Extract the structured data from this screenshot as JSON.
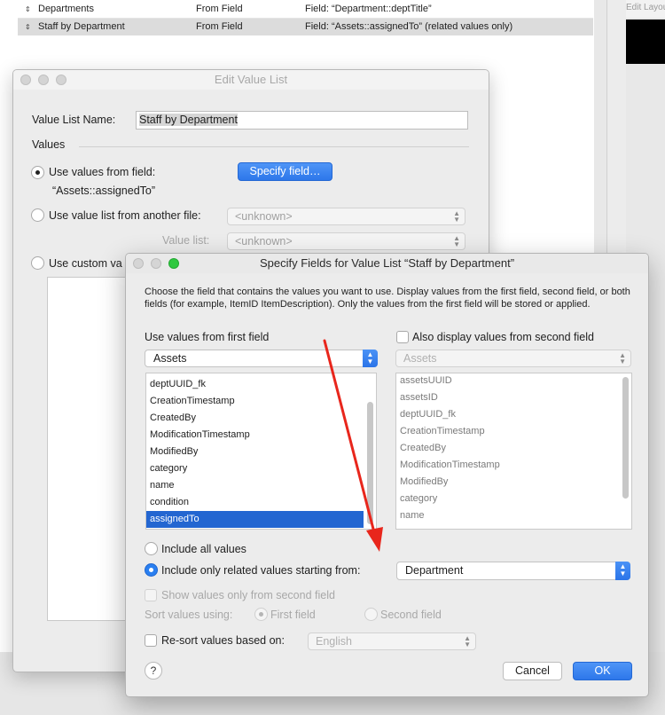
{
  "background_list": {
    "rows": [
      {
        "name": "Departments",
        "type": "From Field",
        "source": "Field: “Department::deptTitle”"
      },
      {
        "name": "Staff by Department",
        "type": "From Field",
        "source": "Field: “Assets::assignedTo” (related values only)"
      }
    ],
    "layout_panel_text": "Edit Layou"
  },
  "edit_value_list": {
    "title": "Edit Value List",
    "name_label": "Value List Name:",
    "name_value": "Staff by Department",
    "values_heading": "Values",
    "use_field_label": "Use values from field:",
    "field_name": "“Assets::assignedTo”",
    "specify_button": "Specify field…",
    "another_file_label": "Use value list from another file:",
    "file_popup": "<unknown>",
    "value_list_label": "Value list:",
    "value_list_popup": "<unknown>",
    "custom_label": "Use custom va"
  },
  "specify_fields": {
    "title": "Specify Fields for Value List “Staff by Department”",
    "description": "Choose the field that contains the values you want to use.  Display values from the first field, second field, or both fields (for example, ItemID ItemDescription). Only the values from the first field will be stored or applied.",
    "first_field_label": "Use values from first field",
    "second_field_label": "Also display values from second field",
    "table1": "Assets",
    "table2": "Assets",
    "fields1": [
      "deptUUID_fk",
      "CreationTimestamp",
      "CreatedBy",
      "ModificationTimestamp",
      "ModifiedBy",
      "category",
      "name",
      "condition",
      "assignedTo"
    ],
    "fields2": [
      "assetsUUID",
      "assetsID",
      "deptUUID_fk",
      "CreationTimestamp",
      "CreatedBy",
      "ModificationTimestamp",
      "ModifiedBy",
      "category",
      "name"
    ],
    "selected_field": "assignedTo",
    "include_all_label": "Include all values",
    "include_related_label": "Include only related values starting from:",
    "related_table": "Department",
    "show_second_label": "Show values only from second field",
    "sort_label": "Sort values using:",
    "sort_first_label": "First field",
    "sort_second_label": "Second field",
    "resort_label": "Re-sort values based on:",
    "language": "English",
    "help_label": "?",
    "cancel_label": "Cancel",
    "ok_label": "OK"
  },
  "colors": {
    "accent": "#2d77ea",
    "selection": "#2366d1",
    "annotation_arrow": "#e8261c"
  }
}
